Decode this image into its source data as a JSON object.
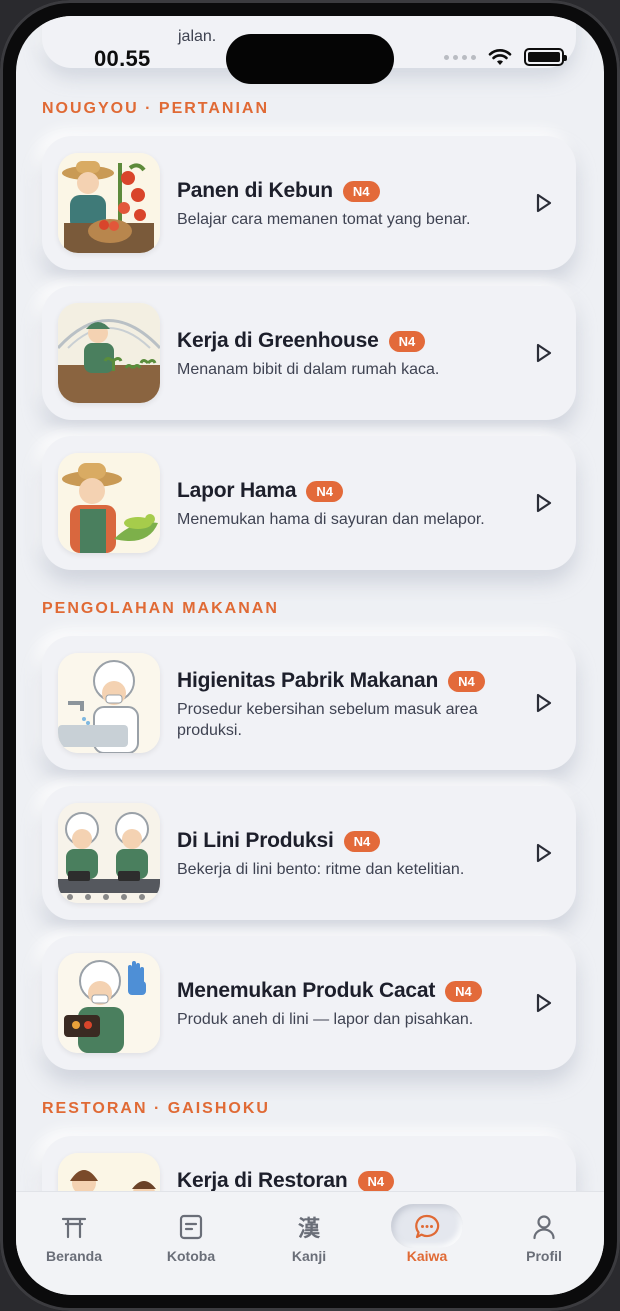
{
  "status_bar": {
    "time": "00.55"
  },
  "previous_card": {
    "desc_fragment": "jalan."
  },
  "sections": [
    {
      "title": "NOUGYOU · PERTANIAN",
      "lessons": [
        {
          "title": "Panen di Kebun",
          "level": "N4",
          "desc": "Belajar cara memanen tomat yang benar.",
          "image": "farmer-harvest-tomato"
        },
        {
          "title": "Kerja di Greenhouse",
          "level": "N4",
          "desc": "Menanam bibit di dalam rumah kaca.",
          "image": "greenhouse-worker"
        },
        {
          "title": "Lapor Hama",
          "level": "N4",
          "desc": "Menemukan hama di sayuran dan melapor.",
          "image": "farmer-pest-caterpillar"
        }
      ]
    },
    {
      "title": "PENGOLAHAN MAKANAN",
      "lessons": [
        {
          "title": "Higienitas Pabrik Makanan",
          "level": "N4",
          "desc": "Prosedur kebersihan sebelum masuk area produksi.",
          "image": "worker-handwash"
        },
        {
          "title": "Di Lini Produksi",
          "level": "N4",
          "desc": "Bekerja di lini bento: ritme dan ketelitian.",
          "image": "bento-line-workers"
        },
        {
          "title": "Menemukan Produk Cacat",
          "level": "N4",
          "desc": "Produk aneh di lini — lapor dan pisahkan.",
          "image": "worker-defect-bento"
        }
      ]
    },
    {
      "title": "RESTORAN · GAISHOKU",
      "lessons": [
        {
          "title": "Kerja di Restoran",
          "level": "N4",
          "desc": "",
          "image": "restaurant-staff"
        }
      ]
    }
  ],
  "bottom_nav": {
    "items": [
      {
        "label": "Beranda",
        "icon": "torii-icon"
      },
      {
        "label": "Kotoba",
        "icon": "card-icon"
      },
      {
        "label": "Kanji",
        "icon": "kanji-icon",
        "glyph": "漢"
      },
      {
        "label": "Kaiwa",
        "icon": "chat-bubble-icon"
      },
      {
        "label": "Profil",
        "icon": "person-icon"
      }
    ],
    "active": "Kaiwa"
  },
  "colors": {
    "accent": "#e06a35",
    "badge": "#e36a3a",
    "background": "#eef0f4",
    "card": "#f1f2f6"
  }
}
